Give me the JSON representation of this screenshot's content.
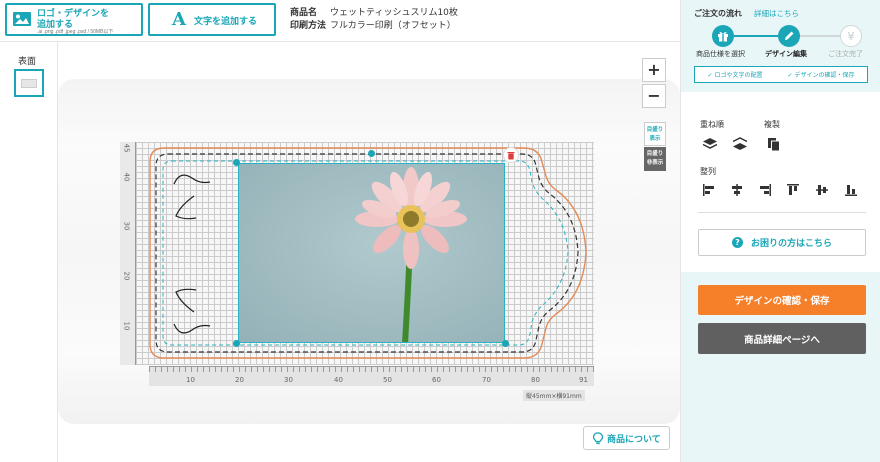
{
  "toolbar": {
    "logo_btn_line1": "ロゴ・デザインを",
    "logo_btn_line2": "追加する",
    "logo_btn_formats": ".ai .png .pdf .jpeg .psd / 50MB以下",
    "text_btn": "文字を追加する"
  },
  "product": {
    "name_label": "商品名",
    "name_value": "ウェットティッシュスリム10枚",
    "print_label": "印刷方法",
    "print_value": "フルカラー印刷（オフセット）"
  },
  "pages": {
    "front_label": "表面"
  },
  "canvas": {
    "zoom_in": "+",
    "zoom_out": "−",
    "grid_show_1": "目盛り",
    "grid_show_2": "表示",
    "grid_hide_1": "目盛り",
    "grid_hide_2": "非表示",
    "ruler_x": [
      "10",
      "20",
      "30",
      "40",
      "50",
      "60",
      "70",
      "80",
      "91"
    ],
    "ruler_y": [
      "45",
      "40",
      "30",
      "20",
      "10"
    ],
    "size_note": "縦45mm×横91mm",
    "about_btn": "商品について"
  },
  "flow": {
    "title": "ご注文の流れ",
    "detail_link": "詳細はこちら",
    "steps": [
      "商品仕様を選択",
      "デザイン編集",
      "ご注文完了"
    ],
    "checks": [
      "ロゴや文字の配置",
      "デザインの確認・保存"
    ]
  },
  "tools": {
    "order_label": "重ね順",
    "duplicate_label": "複製",
    "align_label": "整列",
    "help_btn": "お困りの方はこちら",
    "confirm_btn": "デザインの確認・保存",
    "detail_btn": "商品詳細ページへ"
  },
  "colors": {
    "accent": "#1aa6b7",
    "orange": "#f6802a",
    "dark": "#606060"
  }
}
